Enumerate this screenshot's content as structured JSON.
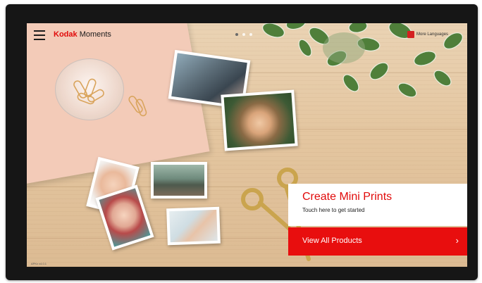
{
  "header": {
    "brand_name": "Kodak",
    "brand_suffix": "Moments",
    "language_label": "More Languages",
    "pagination": {
      "count": 3,
      "active": 1
    }
  },
  "cta": {
    "title": "Create Mini Prints",
    "subtitle": "Touch here to get started"
  },
  "view_all": {
    "label": "View All Products",
    "arrow": "›"
  },
  "footer": {
    "version": "APKx v4.0.1"
  },
  "colors": {
    "accent": "#e80e0e",
    "brand_red": "#e10a0a",
    "bezel": "#161616"
  },
  "icons": {
    "menu": "hamburger-icon",
    "language": "flag-icon",
    "next": "chevron-right-icon"
  }
}
